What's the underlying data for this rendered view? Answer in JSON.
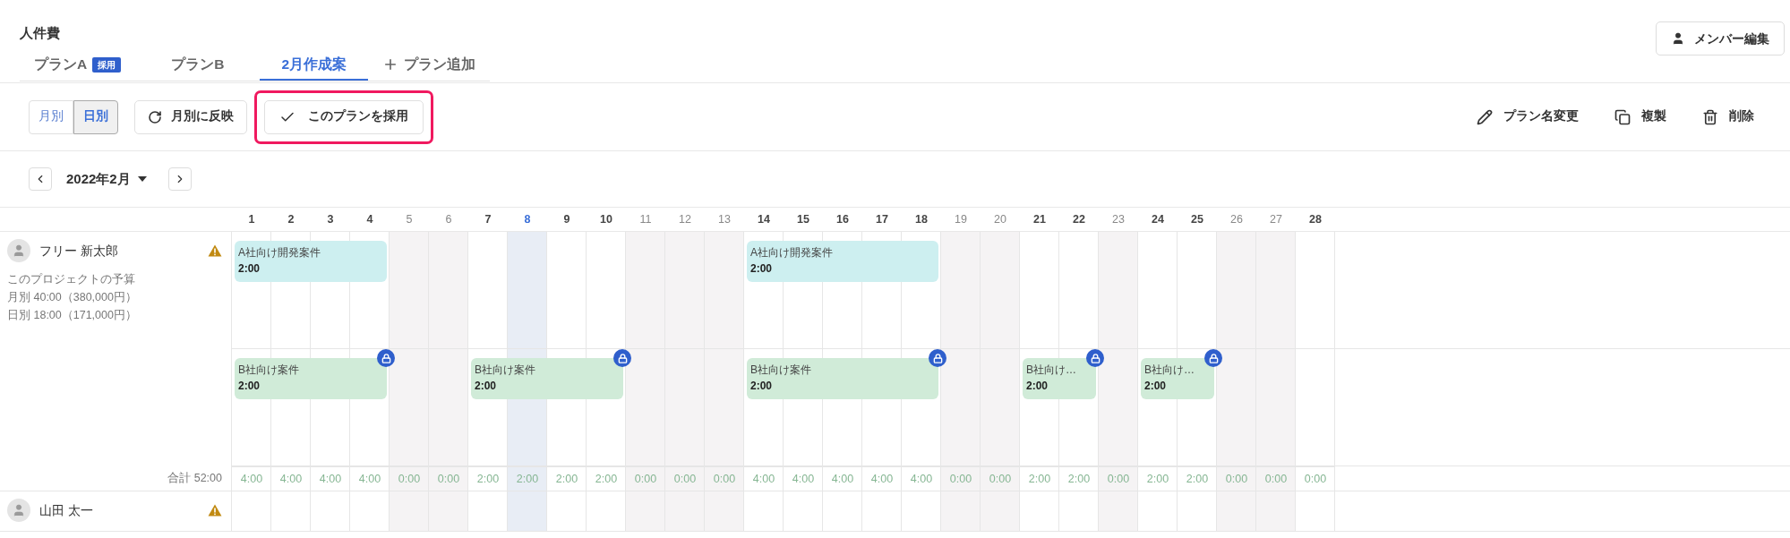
{
  "title": "人件費",
  "member_edit": "メンバー編集",
  "tabs": [
    {
      "kind": "plan",
      "label": "プランA",
      "badge": "採用",
      "selected": false
    },
    {
      "kind": "plan",
      "label": "プランB",
      "selected": false
    },
    {
      "kind": "plan",
      "label": "2月作成案",
      "selected": true
    },
    {
      "kind": "add",
      "label": "プラン追加",
      "selected": false
    }
  ],
  "view_toggle": [
    {
      "label": "月別",
      "selected": false
    },
    {
      "label": "日別",
      "selected": true
    }
  ],
  "reflect_button": "月別に反映",
  "adopt_button": {
    "label": "このプランを採用",
    "highlighted": true
  },
  "actions": [
    {
      "kind": "rename",
      "label": "プラン名変更"
    },
    {
      "kind": "copy",
      "label": "複製"
    },
    {
      "kind": "delete",
      "label": "削除"
    }
  ],
  "month": "2022年2月",
  "days": [
    {
      "label": "1",
      "off": false,
      "selected": false
    },
    {
      "label": "2",
      "off": false,
      "selected": false
    },
    {
      "label": "3",
      "off": false,
      "selected": false
    },
    {
      "label": "4",
      "off": false,
      "selected": false
    },
    {
      "label": "5",
      "off": true,
      "selected": false
    },
    {
      "label": "6",
      "off": true,
      "selected": false
    },
    {
      "label": "7",
      "off": false,
      "selected": false
    },
    {
      "label": "8",
      "off": false,
      "selected": true
    },
    {
      "label": "9",
      "off": false,
      "selected": false
    },
    {
      "label": "10",
      "off": false,
      "selected": false
    },
    {
      "label": "11",
      "off": true,
      "selected": false
    },
    {
      "label": "12",
      "off": true,
      "selected": false
    },
    {
      "label": "13",
      "off": true,
      "selected": false
    },
    {
      "label": "14",
      "off": false,
      "selected": false
    },
    {
      "label": "15",
      "off": false,
      "selected": false
    },
    {
      "label": "16",
      "off": false,
      "selected": false
    },
    {
      "label": "17",
      "off": false,
      "selected": false
    },
    {
      "label": "18",
      "off": false,
      "selected": false
    },
    {
      "label": "19",
      "off": true,
      "selected": false
    },
    {
      "label": "20",
      "off": true,
      "selected": false
    },
    {
      "label": "21",
      "off": false,
      "selected": false
    },
    {
      "label": "22",
      "off": false,
      "selected": false
    },
    {
      "label": "23",
      "off": true,
      "selected": false
    },
    {
      "label": "24",
      "off": false,
      "selected": false
    },
    {
      "label": "25",
      "off": false,
      "selected": false
    },
    {
      "label": "26",
      "off": true,
      "selected": false
    },
    {
      "label": "27",
      "off": true,
      "selected": false
    },
    {
      "label": "28",
      "off": false,
      "selected": false
    }
  ],
  "members": [
    {
      "name": "フリー 新太郎",
      "warning": true,
      "budget_title": "このプロジェクトの予算",
      "budget_lines": [
        "月別 40:00（380,000円）",
        "日別 18:00（171,000円）"
      ],
      "lanes": [
        {
          "cells": [
            {
              "kind": "bar",
              "project": "A社向け開発案件",
              "hours": "2:00",
              "color": "#cdeff0",
              "locked": false
            },
            {
              "kind": "cont"
            },
            {
              "kind": "cont"
            },
            {
              "kind": "cont"
            },
            {
              "kind": "empty"
            },
            {
              "kind": "empty"
            },
            {
              "kind": "empty"
            },
            {
              "kind": "empty"
            },
            {
              "kind": "empty"
            },
            {
              "kind": "empty"
            },
            {
              "kind": "empty"
            },
            {
              "kind": "empty"
            },
            {
              "kind": "empty"
            },
            {
              "kind": "bar",
              "project": "A社向け開発案件",
              "hours": "2:00",
              "color": "#cdeff0",
              "locked": false
            },
            {
              "kind": "cont"
            },
            {
              "kind": "cont"
            },
            {
              "kind": "cont"
            },
            {
              "kind": "cont"
            },
            {
              "kind": "empty"
            },
            {
              "kind": "empty"
            },
            {
              "kind": "empty"
            },
            {
              "kind": "empty"
            },
            {
              "kind": "empty"
            },
            {
              "kind": "empty"
            },
            {
              "kind": "empty"
            },
            {
              "kind": "empty"
            },
            {
              "kind": "empty"
            },
            {
              "kind": "empty"
            }
          ]
        },
        {
          "cells": [
            {
              "kind": "bar",
              "project": "B社向け案件",
              "hours": "2:00",
              "color": "#d0ebd8",
              "locked": true
            },
            {
              "kind": "cont"
            },
            {
              "kind": "cont"
            },
            {
              "kind": "cont"
            },
            {
              "kind": "empty"
            },
            {
              "kind": "empty"
            },
            {
              "kind": "bar",
              "project": "B社向け案件",
              "hours": "2:00",
              "color": "#d0ebd8",
              "locked": true
            },
            {
              "kind": "cont"
            },
            {
              "kind": "cont"
            },
            {
              "kind": "cont"
            },
            {
              "kind": "empty"
            },
            {
              "kind": "empty"
            },
            {
              "kind": "empty"
            },
            {
              "kind": "bar",
              "project": "B社向け案件",
              "hours": "2:00",
              "color": "#d0ebd8",
              "locked": true
            },
            {
              "kind": "cont"
            },
            {
              "kind": "cont"
            },
            {
              "kind": "cont"
            },
            {
              "kind": "cont"
            },
            {
              "kind": "empty"
            },
            {
              "kind": "empty"
            },
            {
              "kind": "bar",
              "project": "B社向け…",
              "hours": "2:00",
              "color": "#d0ebd8",
              "locked": true
            },
            {
              "kind": "cont"
            },
            {
              "kind": "empty"
            },
            {
              "kind": "bar",
              "project": "B社向け…",
              "hours": "2:00",
              "color": "#d0ebd8",
              "locked": true
            },
            {
              "kind": "cont"
            },
            {
              "kind": "empty"
            },
            {
              "kind": "empty"
            },
            {
              "kind": "empty"
            }
          ]
        }
      ],
      "total": "合計 52:00",
      "daily": [
        "4:00",
        "4:00",
        "4:00",
        "4:00",
        "0:00",
        "0:00",
        "2:00",
        "2:00",
        "2:00",
        "2:00",
        "0:00",
        "0:00",
        "0:00",
        "4:00",
        "4:00",
        "4:00",
        "4:00",
        "4:00",
        "0:00",
        "0:00",
        "2:00",
        "2:00",
        "0:00",
        "2:00",
        "2:00",
        "0:00",
        "0:00",
        "0:00"
      ]
    },
    {
      "name": "山田 太一",
      "warning": true
    }
  ]
}
